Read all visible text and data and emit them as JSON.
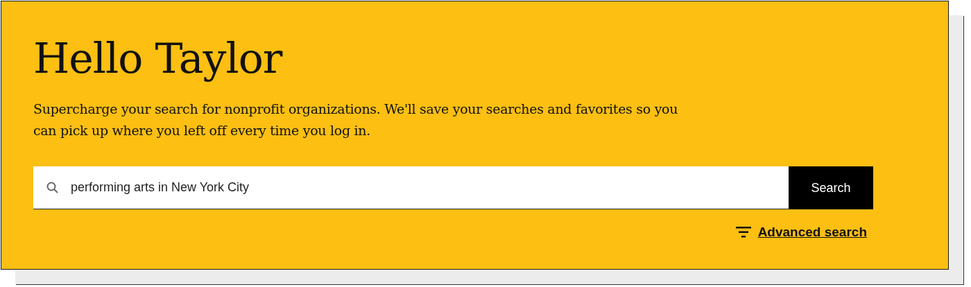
{
  "greeting": {
    "title": "Hello Taylor",
    "description": "Supercharge your search for nonprofit organizations. We'll save your searches and favorites so you can pick up where you left off every time you log in."
  },
  "search": {
    "value": "performing arts in New York City",
    "button": "Search"
  },
  "advanced_link": "Advanced search"
}
